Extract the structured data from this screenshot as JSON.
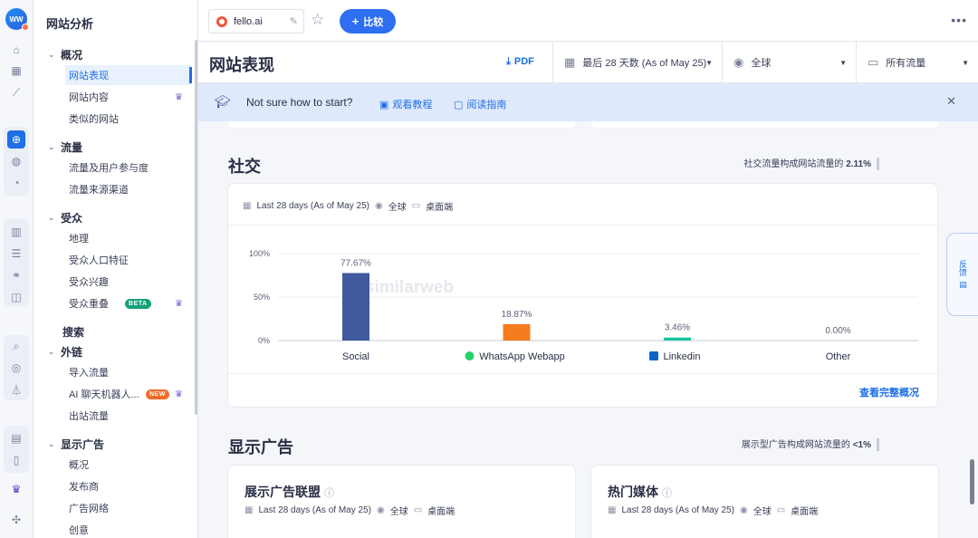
{
  "app": {
    "logo_text": "WW",
    "nav_title": "网站分析"
  },
  "rail_icons": [
    "home-icon",
    "grid-icon",
    "trend-icon",
    "globe-icon",
    "palette-icon",
    "pie-icon",
    "bars-icon",
    "search-list-icon",
    "link-icon",
    "tag-icon",
    "zoom-icon",
    "target-icon",
    "filter-icon",
    "doc-check-icon",
    "phone-icon",
    "crown-icon",
    "puzzle-icon"
  ],
  "nav": {
    "sections": [
      {
        "label": "概况",
        "items": [
          {
            "label": "网站表现",
            "active": true
          },
          {
            "label": "网站内容",
            "crown": true
          },
          {
            "label": "类似的网站"
          }
        ]
      },
      {
        "label": "流量",
        "items": [
          {
            "label": "流量及用户参与度"
          },
          {
            "label": "流量来源渠道"
          }
        ]
      },
      {
        "label": "受众",
        "items": [
          {
            "label": "地理"
          },
          {
            "label": "受众人口特征"
          },
          {
            "label": "受众兴趣"
          },
          {
            "label": "受众重叠",
            "badge": "BETA",
            "crown": true
          }
        ]
      },
      {
        "label": "搜索",
        "items": []
      },
      {
        "label": "外链",
        "items": [
          {
            "label": "导入流量"
          },
          {
            "label": "AI 聊天机器人...",
            "badge": "NEW",
            "crown": true
          },
          {
            "label": "出站流量"
          }
        ]
      },
      {
        "label": "显示广告",
        "items": [
          {
            "label": "概况"
          },
          {
            "label": "发布商"
          },
          {
            "label": "广告网络"
          },
          {
            "label": "创意"
          }
        ]
      }
    ]
  },
  "topbar": {
    "site": "fello.ai",
    "compare_label": "比较",
    "more_label": "•••"
  },
  "page": {
    "title": "网站表现",
    "pdf_label": "PDF",
    "filters": {
      "date": "最后 28 天数 (As of May 25)",
      "country": "全球",
      "traffic": "所有流量"
    }
  },
  "banner": {
    "message": "Not sure how to start?",
    "tutorial": "观看教程",
    "guide": "阅读指南"
  },
  "social": {
    "title": "社交",
    "note_prefix": "社交流量构成网站流量的",
    "note_value": "2.11%",
    "meta": {
      "range": "Last 28 days (As of May 25)",
      "region": "全球",
      "device": "桌面端"
    },
    "full_link": "查看完整概况",
    "watermark": "similarweb"
  },
  "chart_data": {
    "type": "bar",
    "categories": [
      "Social",
      "WhatsApp Webapp",
      "Linkedin",
      "Other"
    ],
    "values": [
      77.67,
      18.87,
      3.46,
      0.0
    ],
    "value_labels": [
      "77.67%",
      "18.87%",
      "3.46%",
      "0.00%"
    ],
    "colors": [
      "#3f5a9e",
      "#f57c1f",
      "#19c4a0",
      "#cccccc"
    ],
    "y_ticks": [
      "100%",
      "50%",
      "0%"
    ],
    "ylim": [
      0,
      100
    ],
    "grid": true
  },
  "display_ads": {
    "title": "显示广告",
    "note_prefix": "展示型广告构成网站流量的",
    "note_value": "<1%",
    "cards": [
      {
        "title": "展示广告联盟",
        "range": "Last 28 days (As of May 25)",
        "region": "全球",
        "device": "桌面端"
      },
      {
        "title": "热门媒体",
        "range": "Last 28 days (As of May 25)",
        "region": "全球",
        "device": "桌面端"
      }
    ]
  },
  "feedback_label": "反馈"
}
